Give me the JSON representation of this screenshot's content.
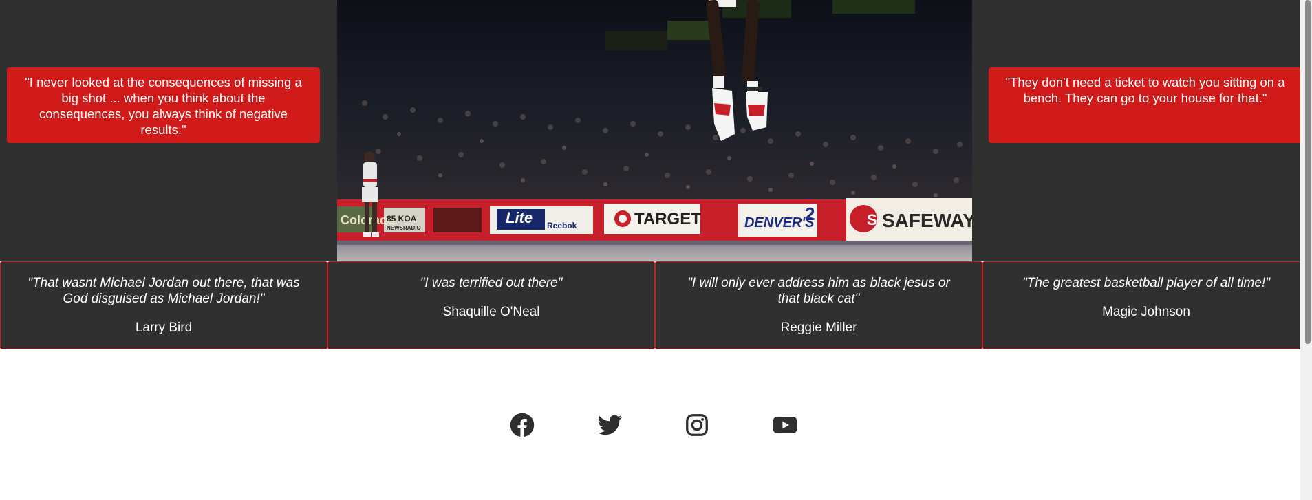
{
  "hero": {
    "left_quote": "\"I never looked at the consequences of missing a big shot ... when you think about the consequences, you always think of negative results.\"",
    "right_quote": "\"They don't need a ticket to watch you sitting on a bench. They can go to your house for that.\"",
    "photo": {
      "boards": [
        "85 KOA NEWSRADIO",
        "Lite BEER",
        "Reebok",
        "TARGET",
        "DENVER'S 2",
        "SAFEWAY"
      ]
    }
  },
  "testimonials": [
    {
      "quote": "\"That wasnt Michael Jordan out there, that was God disguised as Michael Jordan!\"",
      "author": "Larry Bird"
    },
    {
      "quote": "\"I was terrified out there\"",
      "author": "Shaquille O'Neal"
    },
    {
      "quote": "\"I will only ever address him as black jesus or that black cat\"",
      "author": "Reggie Miller"
    },
    {
      "quote": "\"The greatest basketball player of all time!\"",
      "author": "Magic Johnson"
    }
  ],
  "social": [
    {
      "icon": "facebook-icon"
    },
    {
      "icon": "twitter-icon"
    },
    {
      "icon": "instagram-icon"
    },
    {
      "icon": "youtube-icon"
    }
  ],
  "colors": {
    "accent_red": "#d11a1a",
    "dark_bg": "#303030",
    "icon_color": "#2f2f2f"
  }
}
